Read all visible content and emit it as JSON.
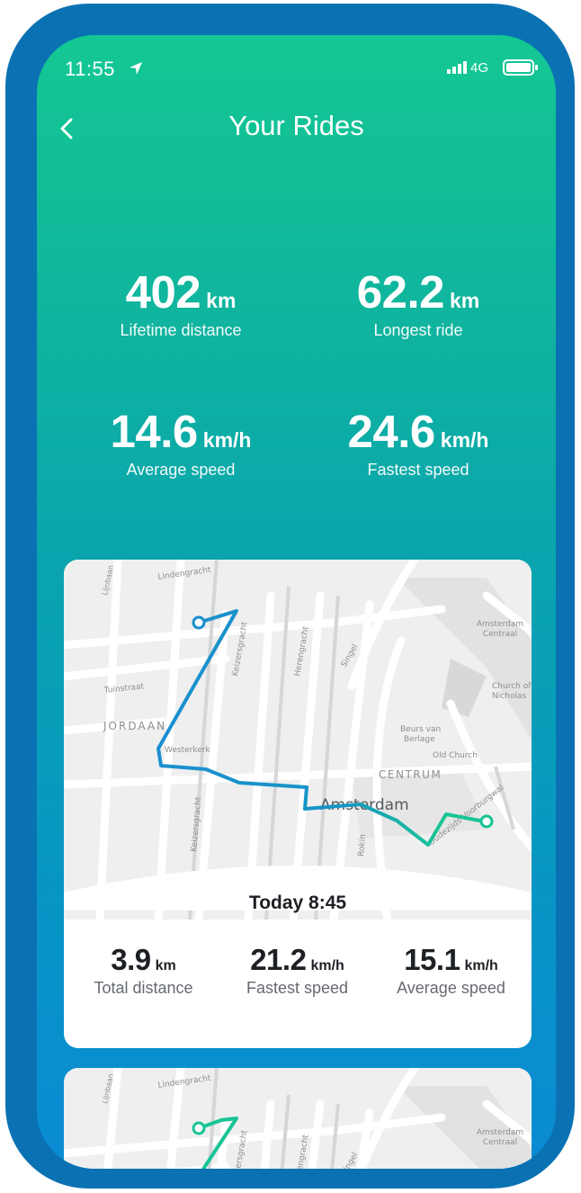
{
  "status_bar": {
    "time": "11:55",
    "network": "4G"
  },
  "header": {
    "title": "Your Rides"
  },
  "summary": [
    {
      "value": "402",
      "unit": "km",
      "label": "Lifetime distance"
    },
    {
      "value": "62.2",
      "unit": "km",
      "label": "Longest ride"
    },
    {
      "value": "14.6",
      "unit": "km/h",
      "label": "Average speed"
    },
    {
      "value": "24.6",
      "unit": "km/h",
      "label": "Fastest speed"
    }
  ],
  "map_labels": {
    "lindengracht": "Lindengracht",
    "lijnbaan": "Lijnbaan",
    "tuinstraat": "Tuinstraat",
    "jordaan": "JORDAAN",
    "westerkerk": "Westerkerk",
    "keizersgracht": "Keizersgracht",
    "herengracht": "Herengracht",
    "singel": "Singel",
    "amsterdam_centraal_1": "Amsterdam",
    "amsterdam_centraal_2": "Centraal",
    "church_1": "Church of",
    "church_2": "Nicholas",
    "beurs_1": "Beurs van",
    "beurs_2": "Berlage",
    "old_church": "Old Church",
    "centrum": "CENTRUM",
    "amsterdam": "Amsterdam",
    "oudezijds": "Oudezijds Voorburgwal",
    "rokin": "Rokin"
  },
  "rides": [
    {
      "date": "Today 8:45",
      "stats": [
        {
          "value": "3.9",
          "unit": "km",
          "label": "Total distance"
        },
        {
          "value": "21.2",
          "unit": "km/h",
          "label": "Fastest speed"
        },
        {
          "value": "15.1",
          "unit": "km/h",
          "label": "Average speed"
        }
      ]
    }
  ],
  "colors": {
    "route_start": "#1b8fd0",
    "route_end": "#18c496",
    "accent": "#13c893"
  }
}
